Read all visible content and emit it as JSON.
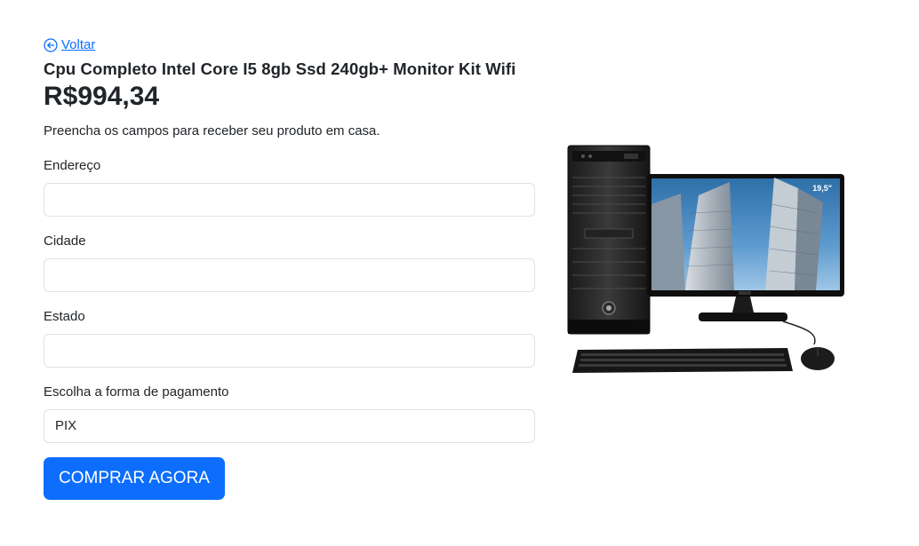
{
  "nav": {
    "back_label": "Voltar"
  },
  "product": {
    "title": "Cpu Completo Intel Core I5 8gb Ssd 240gb+ Monitor Kit Wifi",
    "price": "R$994,34",
    "image_alt": "Cpu, monitor, teclado e mouse",
    "monitor_badge": "19,5\""
  },
  "form": {
    "instructions": "Preencha os campos para receber seu produto em casa.",
    "address": {
      "label": "Endereço",
      "value": ""
    },
    "city": {
      "label": "Cidade",
      "value": ""
    },
    "state": {
      "label": "Estado",
      "value": ""
    },
    "payment": {
      "label": "Escolha a forma de pagamento",
      "selected": "PIX"
    },
    "submit_label": "COMPRAR AGORA"
  },
  "colors": {
    "primary": "#0d6efd",
    "text": "#212529",
    "border": "#dee2e6"
  },
  "icons": {
    "back": "arrow-left-circle-icon"
  }
}
